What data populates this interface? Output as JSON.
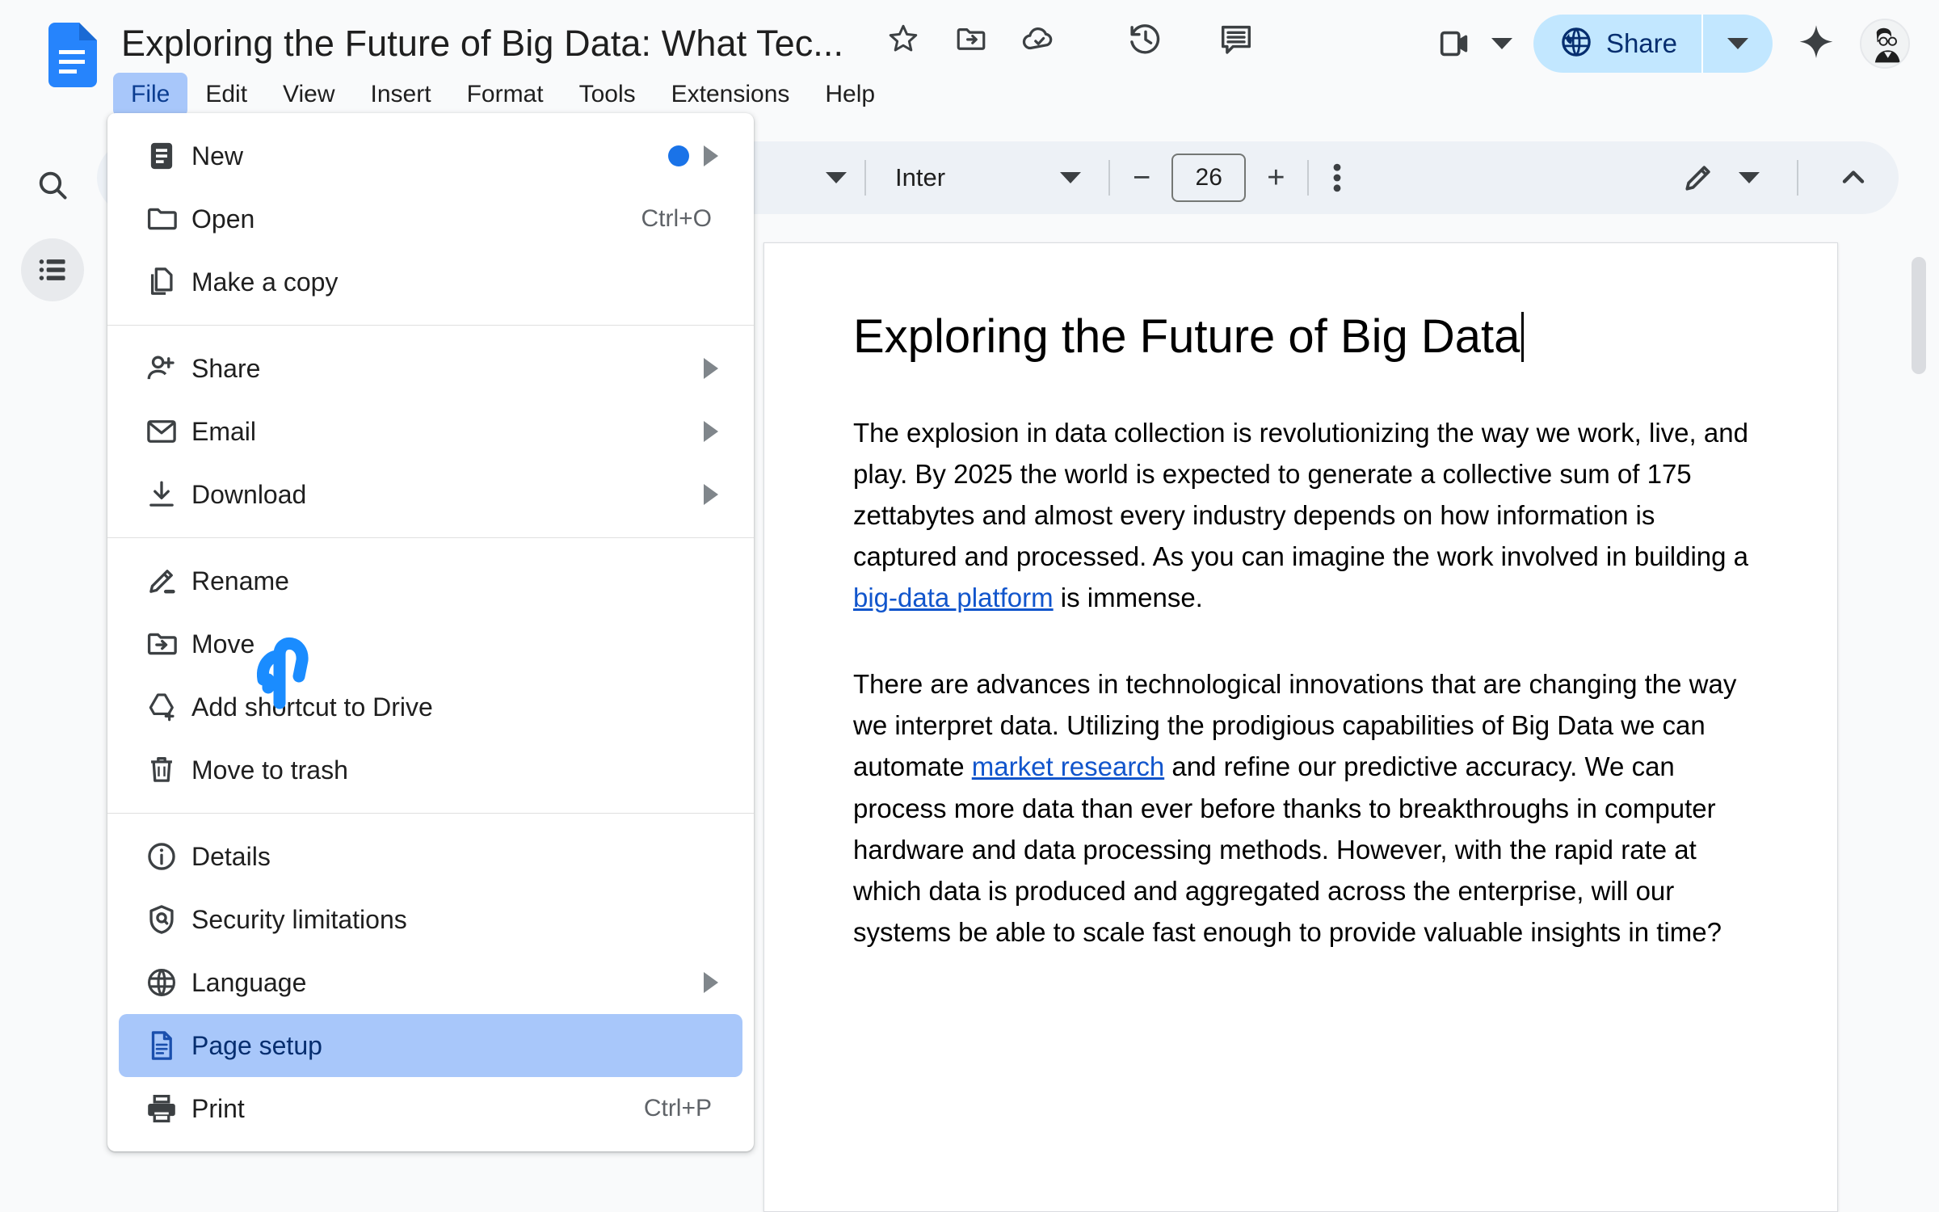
{
  "app": {
    "name": "Google Docs",
    "logo_icon": "docs-logo-icon"
  },
  "header": {
    "doc_title": "Exploring the Future of Big Data: What Tec...",
    "icons": [
      {
        "name": "star-icon",
        "label": "Star"
      },
      {
        "name": "move-to-folder-icon",
        "label": "Move"
      },
      {
        "name": "cloud-saved-icon",
        "label": "Saved to Drive"
      },
      {
        "name": "version-history-icon",
        "label": "Version history"
      },
      {
        "name": "comment-history-icon",
        "label": "Open comment history"
      },
      {
        "name": "video-camera-icon",
        "label": "Join a call"
      }
    ],
    "share": {
      "label": "Share",
      "globe_icon": "globe-icon",
      "caret_icon": "chevron-down-icon",
      "bg_color": "#c2e7ff",
      "text_color": "#062e6f"
    },
    "gemini_icon": "gemini-spark-icon",
    "avatar_icon": "user-avatar"
  },
  "menubar": {
    "items": [
      {
        "label": "File",
        "active": true
      },
      {
        "label": "Edit",
        "active": false
      },
      {
        "label": "View",
        "active": false
      },
      {
        "label": "Insert",
        "active": false
      },
      {
        "label": "Format",
        "active": false
      },
      {
        "label": "Tools",
        "active": false
      },
      {
        "label": "Extensions",
        "active": false
      },
      {
        "label": "Help",
        "active": false
      }
    ],
    "active_bg": "#a8c7fa"
  },
  "rail": {
    "search_icon": "search-icon",
    "outline_icon": "document-outline-icon"
  },
  "toolbar": {
    "style_caret_icon": "chevron-down-icon",
    "font_name": "Inter",
    "font_caret_icon": "chevron-down-icon",
    "decrease_label": "−",
    "font_size": "26",
    "increase_label": "+",
    "more_icon": "more-vertical-icon",
    "editing_mode_icon": "pencil-icon",
    "editing_caret_icon": "chevron-down-icon",
    "collapse_icon": "chevron-up-icon"
  },
  "file_menu": {
    "groups": [
      {
        "items": [
          {
            "label": "New",
            "icon": "new-document-icon",
            "badge": "blue-dot",
            "submenu": true,
            "accel": ""
          },
          {
            "label": "Open",
            "icon": "folder-open-icon",
            "accel": "Ctrl+O",
            "submenu": false
          },
          {
            "label": "Make a copy",
            "icon": "copy-icon",
            "accel": "",
            "submenu": false
          }
        ]
      },
      {
        "items": [
          {
            "label": "Share",
            "icon": "person-add-icon",
            "accel": "",
            "submenu": true
          },
          {
            "label": "Email",
            "icon": "email-icon",
            "accel": "",
            "submenu": true
          },
          {
            "label": "Download",
            "icon": "download-icon",
            "accel": "",
            "submenu": true
          }
        ]
      },
      {
        "items": [
          {
            "label": "Rename",
            "icon": "rename-pencil-icon",
            "accel": "",
            "submenu": false
          },
          {
            "label": "Move",
            "icon": "move-folder-icon",
            "accel": "",
            "submenu": false
          },
          {
            "label": "Add shortcut to Drive",
            "icon": "add-shortcut-drive-icon",
            "accel": "",
            "submenu": false
          },
          {
            "label": "Move to trash",
            "icon": "trash-icon",
            "accel": "",
            "submenu": false
          }
        ]
      },
      {
        "items": [
          {
            "label": "Details",
            "icon": "info-icon",
            "accel": "",
            "submenu": false
          },
          {
            "label": "Security limitations",
            "icon": "shield-icon",
            "accel": "",
            "submenu": false
          },
          {
            "label": "Language",
            "icon": "globe-icon",
            "accel": "",
            "submenu": true
          },
          {
            "label": "Page setup",
            "icon": "page-setup-icon",
            "accel": "",
            "submenu": false,
            "highlighted": true
          },
          {
            "label": "Print",
            "icon": "printer-icon",
            "accel": "Ctrl+P",
            "submenu": false
          }
        ]
      }
    ],
    "highlight_color": "#a8c7fa"
  },
  "document": {
    "heading": "Exploring the Future of Big Data",
    "paragraphs": [
      {
        "runs": [
          {
            "text": "The explosion in data collection is revolutionizing the way we work, live, and play. By 2025 the world is expected to generate a collective sum of 175 zettabytes and almost every industry depends on how information is captured and processed. As you can imagine the work involved in building a ",
            "link": false
          },
          {
            "text": "big-data platform",
            "link": true
          },
          {
            "text": " is immense.",
            "link": false
          }
        ]
      },
      {
        "runs": [
          {
            "text": "There are advances in technological innovations that are changing the way we interpret data. Utilizing the prodigious capabilities of Big Data we can automate ",
            "link": false
          },
          {
            "text": "market research",
            "link": true
          },
          {
            "text": " and refine our predictive accuracy. We can process more data than ever before thanks to breakthroughs in computer hardware and data processing methods. However, with the rapid rate at which data is produced and aggregated across the enterprise, will our systems be able to scale fast enough to provide valuable insights in time?",
            "link": false
          }
        ]
      }
    ],
    "link_color": "#1155cc"
  },
  "cursor": {
    "icon": "pointing-hand-cursor",
    "color": "#1a8cff"
  }
}
